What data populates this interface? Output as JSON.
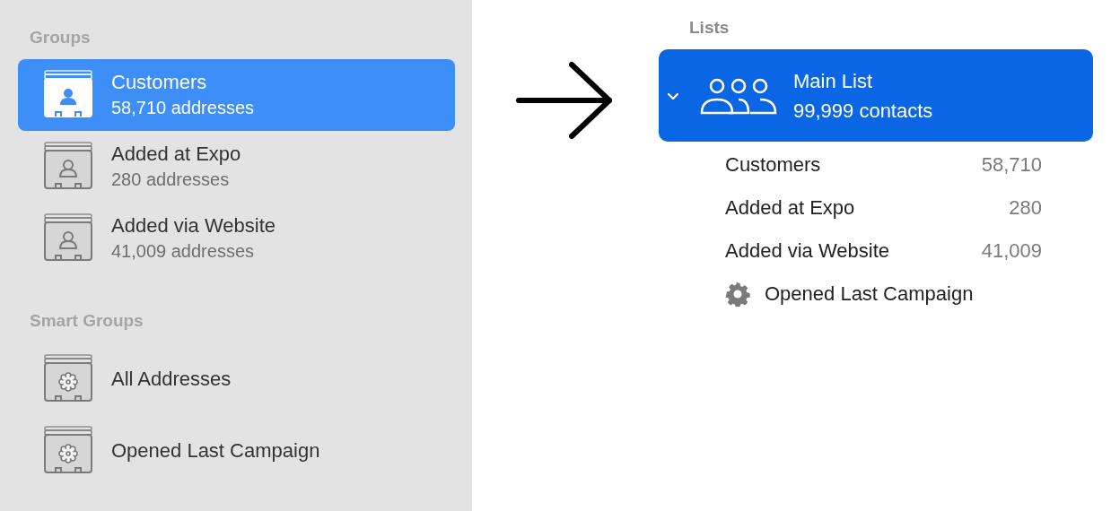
{
  "groups_heading": "Groups",
  "groups": [
    {
      "name": "Customers",
      "count": "58,710 addresses",
      "selected": true,
      "kind": "group"
    },
    {
      "name": "Added at Expo",
      "count": "280 addresses",
      "selected": false,
      "kind": "group"
    },
    {
      "name": "Added via Website",
      "count": "41,009 addresses",
      "selected": false,
      "kind": "group"
    }
  ],
  "smart_groups_heading": "Smart Groups",
  "smart_groups": [
    {
      "name": "All Addresses",
      "selected": false,
      "kind": "smart"
    },
    {
      "name": "Opened Last Campaign",
      "selected": false,
      "kind": "smart"
    }
  ],
  "lists_heading": "Lists",
  "main_list": {
    "name": "Main List",
    "count": "99,999 contacts",
    "expanded": true,
    "selected": true
  },
  "list_items": [
    {
      "name": "Customers",
      "count": "58,710",
      "kind": "group"
    },
    {
      "name": "Added at Expo",
      "count": "280",
      "kind": "group"
    },
    {
      "name": "Added via Website",
      "count": "41,009",
      "kind": "group"
    },
    {
      "name": "Opened Last Campaign",
      "kind": "smart"
    }
  ]
}
